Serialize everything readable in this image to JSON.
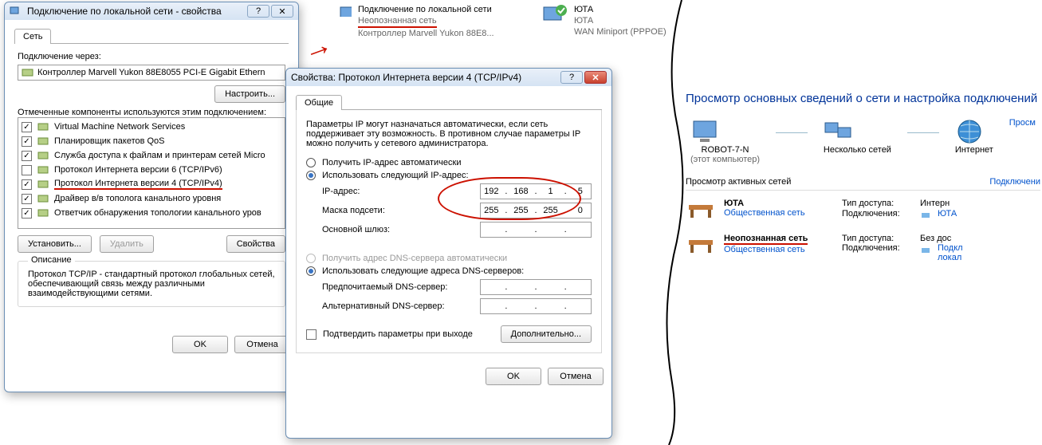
{
  "win1": {
    "title": "Подключение по локальной сети - свойства",
    "tab": "Сеть",
    "conn_label": "Подключение через:",
    "adapter": "Контроллер Marvell Yukon 88E8055 PCI-E Gigabit Ethern",
    "config_btn": "Настроить...",
    "comp_label": "Отмеченные компоненты используются этим подключением:",
    "components": [
      {
        "checked": true,
        "label": "Virtual Machine Network Services"
      },
      {
        "checked": true,
        "label": "Планировщик пакетов QoS"
      },
      {
        "checked": true,
        "label": "Служба доступа к файлам и принтерам сетей Micro"
      },
      {
        "checked": false,
        "label": "Протокол Интернета версии 6 (TCP/IPv6)"
      },
      {
        "checked": true,
        "label": "Протокол Интернета версии 4 (TCP/IPv4)",
        "hl": true
      },
      {
        "checked": true,
        "label": "Драйвер в/в тополога канального уровня"
      },
      {
        "checked": true,
        "label": "Ответчик обнаружения топологии канального уров"
      }
    ],
    "install_btn": "Установить...",
    "remove_btn": "Удалить",
    "props_btn": "Свойства",
    "desc_head": "Описание",
    "desc": "Протокол TCP/IP - стандартный протокол глобальных сетей, обеспечивающий связь между различными взаимодействующими сетями.",
    "ok": "OK",
    "cancel": "Отмена"
  },
  "win2": {
    "title": "Свойства: Протокол Интернета версии 4 (TCP/IPv4)",
    "tab": "Общие",
    "intro": "Параметры IP могут назначаться автоматически, если сеть поддерживает эту возможность. В противном случае параметры IP можно получить у сетевого администратора.",
    "r_auto_ip": "Получить IP-адрес автоматически",
    "r_man_ip": "Использовать следующий IP-адрес:",
    "ip_label": "IP-адрес:",
    "ip": [
      "192",
      "168",
      "1",
      "5"
    ],
    "mask_label": "Маска подсети:",
    "mask": [
      "255",
      "255",
      "255",
      "0"
    ],
    "gw_label": "Основной шлюз:",
    "gw": [
      "",
      "",
      "",
      ""
    ],
    "r_auto_dns": "Получить адрес DNS-сервера автоматически",
    "r_man_dns": "Использовать следующие адреса DNS-серверов:",
    "dns1_label": "Предпочитаемый DNS-сервер:",
    "dns2_label": "Альтернативный DNS-сервер:",
    "validate": "Подтвердить параметры при выходе",
    "adv_btn": "Дополнительно...",
    "ok": "OK",
    "cancel": "Отмена"
  },
  "taskbar": {
    "lan": {
      "title": "Подключение по локальной сети",
      "status": "Неопознанная сеть",
      "device": "Контроллер Marvell Yukon 88E8..."
    },
    "yota": {
      "title": "ЮТА",
      "sub": "ЮТА",
      "device": "WAN Miniport (PPPOE)"
    }
  },
  "center": {
    "heading": "Просмотр основных сведений о сети и настройка подключений",
    "full_map": "Просм",
    "pc": "ROBOT-7-N",
    "pc_sub": "(этот компьютер)",
    "multi": "Несколько сетей",
    "internet": "Интернет",
    "active": "Просмотр активных сетей",
    "connect_link": "Подключени",
    "net1": {
      "name": "ЮТА",
      "type": "Общественная сеть",
      "access_l": "Тип доступа:",
      "access_v": "Интерн",
      "conn_l": "Подключения:",
      "conn_v": "ЮТА"
    },
    "net2": {
      "name": "Неопознанная сеть",
      "type": "Общественная сеть",
      "access_l": "Тип доступа:",
      "access_v": "Без дос",
      "conn_l": "Подключения:",
      "conn_v": "Подкл\nлокал"
    }
  }
}
